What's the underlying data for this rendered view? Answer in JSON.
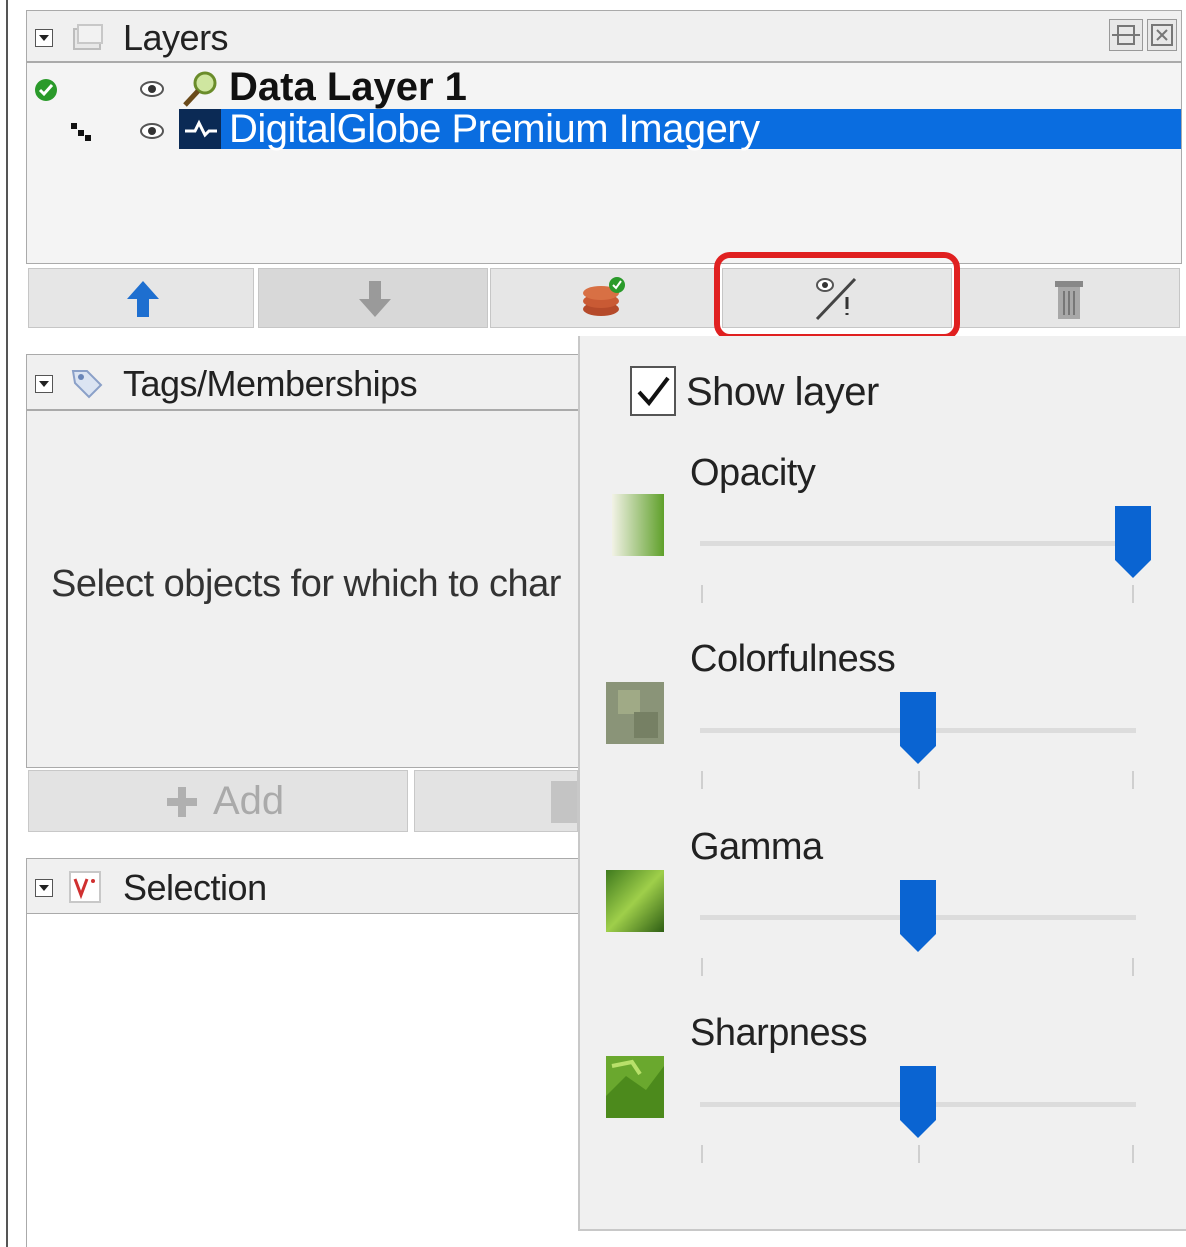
{
  "layers_panel": {
    "title": "Layers",
    "items": [
      {
        "label": "Data Layer 1",
        "visible": true,
        "active": true,
        "selected": false
      },
      {
        "label": "DigitalGlobe Premium Imagery",
        "visible": true,
        "active": false,
        "selected": true
      }
    ],
    "toolbar": [
      "move-up",
      "move-down",
      "layer-manager",
      "visibility-settings",
      "delete-layer"
    ]
  },
  "tags_panel": {
    "title": "Tags/Memberships",
    "message": "Select objects for which to char",
    "add_label": "Add"
  },
  "selection_panel": {
    "title": "Selection"
  },
  "visibility_popup": {
    "show_layer_label": "Show layer",
    "show_layer_checked": true,
    "sliders": [
      {
        "label": "Opacity",
        "value": 1.0
      },
      {
        "label": "Colorfulness",
        "value": 0.5
      },
      {
        "label": "Gamma",
        "value": 0.5
      },
      {
        "label": "Sharpness",
        "value": 0.5
      }
    ]
  },
  "colors": {
    "accent": "#0a64d2",
    "selection_bg": "#0a6de0",
    "highlight_outline": "#e02020"
  }
}
